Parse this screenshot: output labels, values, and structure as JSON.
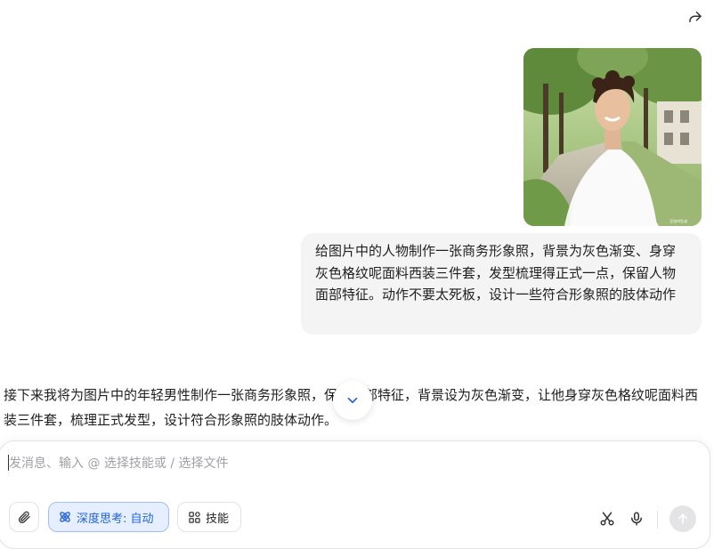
{
  "header": {
    "share_icon": "share-icon"
  },
  "user_message": {
    "image_watermark": "豆包AI生成",
    "text": "给图片中的人物制作一张商务形象照，背景为灰色渐变、身穿灰色格纹呢面料西装三件套，发型梳理得正式一点，保留人物面部特征。动作不要太死板，设计一些符合形象照的肢体动作"
  },
  "assistant_message": {
    "text": "接下来我将为图片中的年轻男性制作一张商务形象照，保留面部特征，背景设为灰色渐变，让他身穿灰色格纹呢面料西装三件套，梳理正式发型，设计符合形象照的肢体动作。"
  },
  "composer": {
    "placeholder": "发消息、输入 @ 选择技能或 / 选择文件",
    "value": "",
    "deep_think_label": "深度思考: 自动",
    "skills_label": "技能"
  },
  "colors": {
    "accent": "#2563d7",
    "accent_bg": "#e6efff",
    "bubble_bg": "#f4f4f5",
    "send_disabled": "#e4e4e7"
  }
}
